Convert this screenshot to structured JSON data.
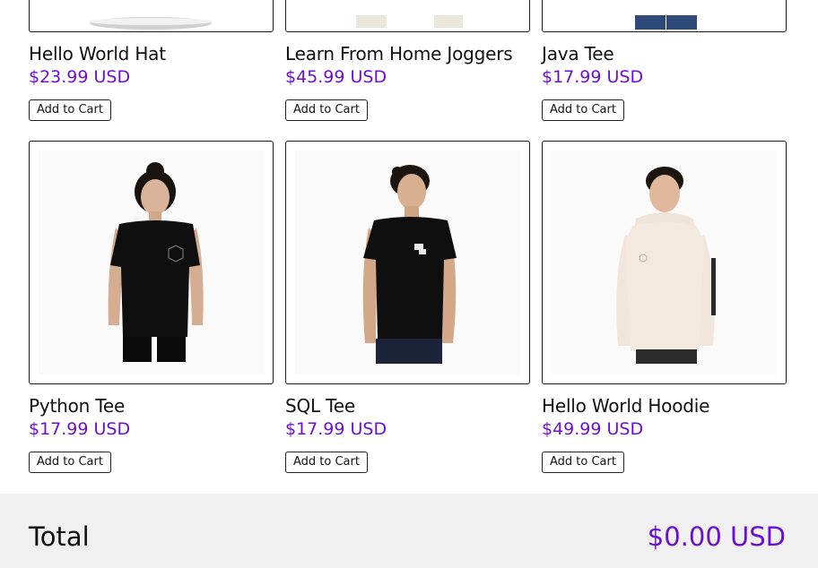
{
  "products": [
    {
      "name": "Hello World Hat",
      "price": "$23.99 USD",
      "button": "Add to Cart",
      "image": "hat-photo"
    },
    {
      "name": "Learn From Home Joggers",
      "price": "$45.99 USD",
      "button": "Add to Cart",
      "image": "joggers-photo"
    },
    {
      "name": "Java Tee",
      "price": "$17.99 USD",
      "button": "Add to Cart",
      "image": "java-tee-photo"
    },
    {
      "name": "Python Tee",
      "price": "$17.99 USD",
      "button": "Add to Cart",
      "image": "python-tee-photo"
    },
    {
      "name": "SQL Tee",
      "price": "$17.99 USD",
      "button": "Add to Cart",
      "image": "sql-tee-photo"
    },
    {
      "name": "Hello World Hoodie",
      "price": "$49.99 USD",
      "button": "Add to Cart",
      "image": "hoodie-photo"
    }
  ],
  "total": {
    "label": "Total",
    "value": "$0.00 USD"
  },
  "colors": {
    "accent": "#6b0fd4",
    "footer_bg": "#f0f0f0"
  }
}
